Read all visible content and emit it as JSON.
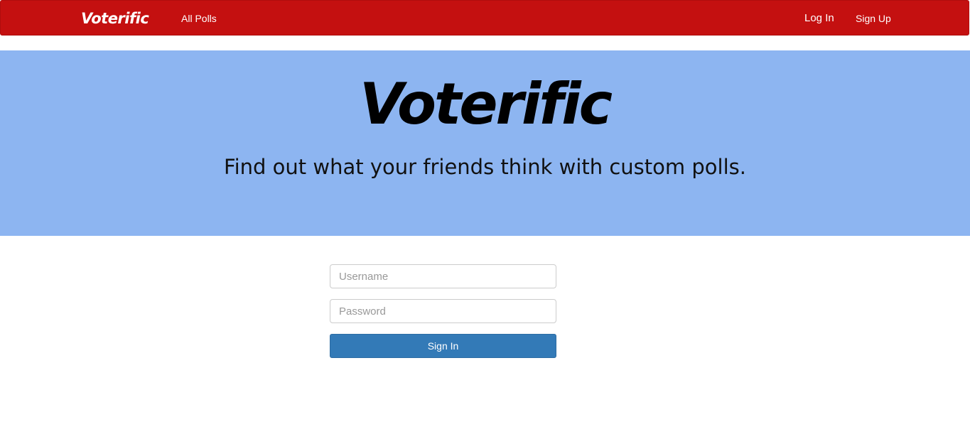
{
  "navbar": {
    "brand": "Voterific",
    "all_polls": "All Polls",
    "log_in": "Log In",
    "sign_up": "Sign Up",
    "background_color": "#c41010"
  },
  "hero": {
    "title": "Voterific",
    "subtitle": "Find out what your friends think with custom polls.",
    "background_color": "#8db5f1"
  },
  "login_form": {
    "username": {
      "value": "",
      "placeholder": "Username"
    },
    "password": {
      "value": "",
      "placeholder": "Password"
    },
    "submit_label": "Sign In",
    "button_color": "#337ab7"
  }
}
